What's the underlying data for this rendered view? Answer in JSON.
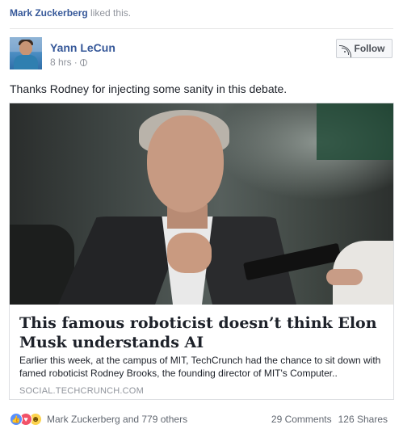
{
  "activity": {
    "actor": "Mark Zuckerberg",
    "action": "liked this."
  },
  "post": {
    "author": "Yann LeCun",
    "time": "8 hrs",
    "privacy_icon": "globe-icon",
    "follow_label": "Follow",
    "text": "Thanks Rodney for injecting some sanity in this debate."
  },
  "link_card": {
    "title": "This famous roboticist doesn’t think Elon Musk understands AI",
    "description": "Earlier this week, at the campus of MIT, TechCrunch had the chance to sit down with famed roboticist Rodney Brooks, the founding director of MIT's Computer..",
    "domain": "SOCIAL.TECHCRUNCH.COM"
  },
  "footer": {
    "reaction_icons": [
      "like-icon",
      "love-icon",
      "haha-icon"
    ],
    "reactions_text": "Mark Zuckerberg and 779 others",
    "comments": "29 Comments",
    "shares": "126 Shares"
  },
  "colors": {
    "link_blue": "#365899",
    "meta_gray": "#90949c",
    "like_blue": "#5890ff",
    "love_red": "#f25268",
    "haha_yellow": "#fcd34d"
  }
}
